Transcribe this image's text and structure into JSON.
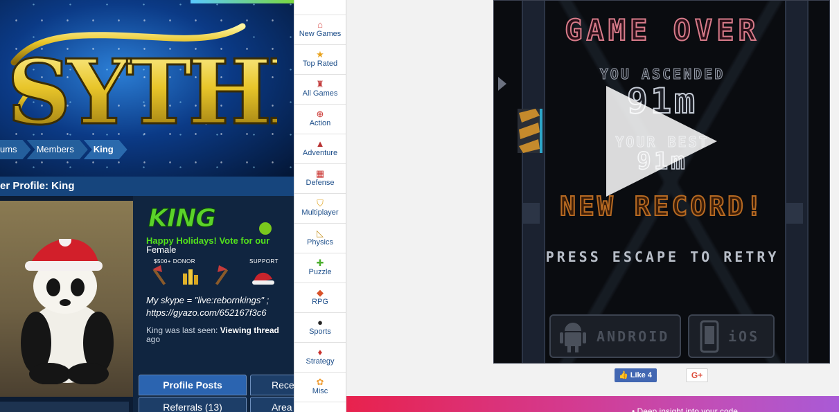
{
  "forum": {
    "breadcrumb": [
      "ums",
      "Members",
      "King"
    ],
    "profile_title": "er Profile: King",
    "username_logo": "KING",
    "holiday_text": "Happy Holidays! Vote for our",
    "gender": "Female",
    "badges": {
      "donor_label": "$500+ DONOR",
      "support_label": "SUPPORT"
    },
    "quote_line1": "My skype = \"live:rebornkings\" ;",
    "quote_line2": "https://gyazo.com/652167f3c6",
    "last_seen_prefix": "King was last seen:",
    "last_seen_activity": "Viewing thread",
    "last_seen_ago": "ago",
    "tabs": [
      {
        "label": "Profile Posts",
        "active": true
      },
      {
        "label": "Rece",
        "active": false
      },
      {
        "label": "Referrals (13)",
        "active": false
      },
      {
        "label": "Area",
        "active": false
      }
    ]
  },
  "categories": [
    {
      "label": "New Games",
      "icon": "home-icon",
      "color": "#d9534f",
      "glyph": "⌂"
    },
    {
      "label": "Top Rated",
      "icon": "medal-icon",
      "color": "#e8a21d",
      "glyph": "★"
    },
    {
      "label": "All Games",
      "icon": "joystick-icon",
      "color": "#c23b3b",
      "glyph": "♜"
    },
    {
      "label": "Action",
      "icon": "crosshair-icon",
      "color": "#c9302c",
      "glyph": "⊕"
    },
    {
      "label": "Adventure",
      "icon": "rocket-icon",
      "color": "#b83232",
      "glyph": "▲"
    },
    {
      "label": "Defense",
      "icon": "brick-wall-icon",
      "color": "#c9302c",
      "glyph": "▦"
    },
    {
      "label": "Multiplayer",
      "icon": "shield-icon",
      "color": "#e0a31f",
      "glyph": "⛉"
    },
    {
      "label": "Physics",
      "icon": "triangle-ruler-icon",
      "color": "#c8962a",
      "glyph": "◺"
    },
    {
      "label": "Puzzle",
      "icon": "puzzle-piece-icon",
      "color": "#4caf2f",
      "glyph": "✚"
    },
    {
      "label": "RPG",
      "icon": "sword-icon",
      "color": "#d9532b",
      "glyph": "◆"
    },
    {
      "label": "Sports",
      "icon": "soccer-ball-icon",
      "color": "#222222",
      "glyph": "●"
    },
    {
      "label": "Strategy",
      "icon": "cards-icon",
      "color": "#c9302c",
      "glyph": "♦"
    },
    {
      "label": "Misc",
      "icon": "flower-icon",
      "color": "#f0a03a",
      "glyph": "✿"
    }
  ],
  "game": {
    "game_over": "GAME OVER",
    "you_ascended": "YOU ASCENDED",
    "ascended_value": "91m",
    "your_best": "YOUR BEST",
    "best_value": "91m",
    "new_record": "NEW RECORD!",
    "escape_prompt": "PRESS ESCAPE TO RETRY",
    "android_label": "ANDROID",
    "ios_label": "iOS"
  },
  "social": {
    "like_label": "Like 4",
    "gplus_label": "G+"
  },
  "promo": {
    "text": "• Deep insight into your code"
  },
  "colors": {
    "forum_bg": "#0c1c33",
    "holiday_green": "#53e01c",
    "link_blue": "#1e4f8a",
    "facebook_blue": "#4267b2",
    "game_over_pink": "#d87b8a",
    "new_record_orange": "#b76a22"
  }
}
